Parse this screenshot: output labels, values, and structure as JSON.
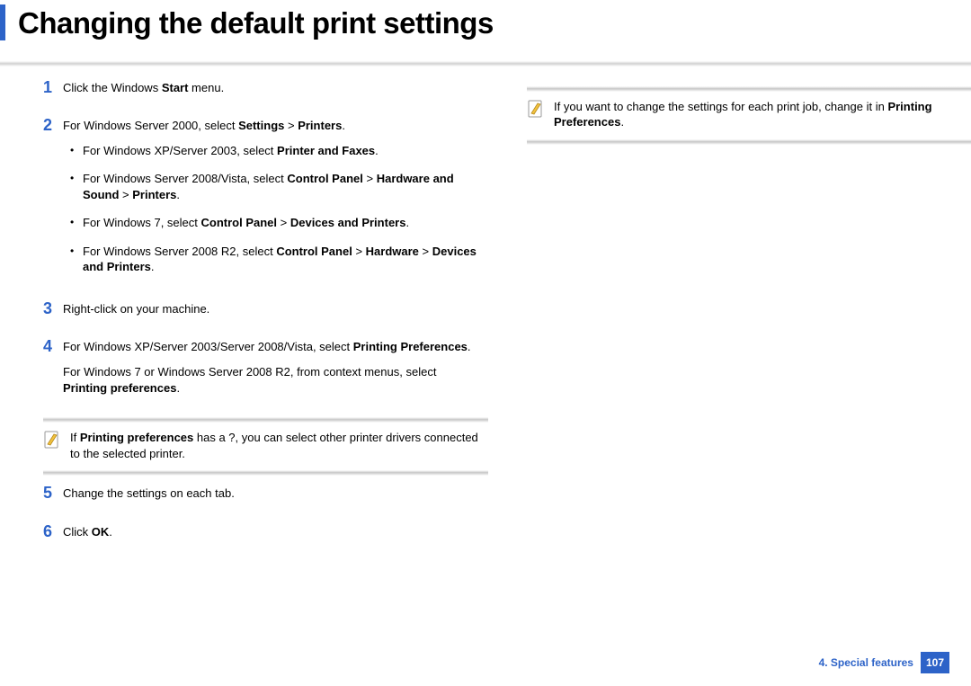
{
  "header": {
    "title": "Changing the default print settings"
  },
  "steps": [
    {
      "num": "1",
      "paras": [
        [
          {
            "t": "Click the Windows "
          },
          {
            "t": "Start",
            "b": true
          },
          {
            "t": " menu."
          }
        ]
      ]
    },
    {
      "num": "2",
      "paras": [
        [
          {
            "t": "For Windows Server 2000, select "
          },
          {
            "t": "Settings",
            "b": true
          },
          {
            "t": " > "
          },
          {
            "t": "Printers",
            "b": true
          },
          {
            "t": "."
          }
        ]
      ],
      "bullets": [
        [
          {
            "t": "For Windows XP/Server 2003, select "
          },
          {
            "t": "Printer and Faxes",
            "b": true
          },
          {
            "t": "."
          }
        ],
        [
          {
            "t": "For Windows Server 2008/Vista, select "
          },
          {
            "t": "Control Panel",
            "b": true
          },
          {
            "t": " > "
          },
          {
            "t": "Hardware and Sound",
            "b": true
          },
          {
            "t": " > "
          },
          {
            "t": "Printers",
            "b": true
          },
          {
            "t": "."
          }
        ],
        [
          {
            "t": "For Windows 7, select "
          },
          {
            "t": "Control Panel",
            "b": true
          },
          {
            "t": " > "
          },
          {
            "t": "Devices and Printers",
            "b": true
          },
          {
            "t": "."
          }
        ],
        [
          {
            "t": "For Windows Server 2008 R2, select "
          },
          {
            "t": "Control Panel",
            "b": true
          },
          {
            "t": " > "
          },
          {
            "t": "Hardware",
            "b": true
          },
          {
            "t": " > "
          },
          {
            "t": "Devices and Printers",
            "b": true
          },
          {
            "t": "."
          }
        ]
      ]
    },
    {
      "num": "3",
      "paras": [
        [
          {
            "t": "Right-click on your machine."
          }
        ]
      ]
    },
    {
      "num": "4",
      "paras": [
        [
          {
            "t": "For Windows XP/Server 2003/Server 2008/Vista, select "
          },
          {
            "t": "Printing Preferences",
            "b": true
          },
          {
            "t": "."
          }
        ],
        [
          {
            "t": "For Windows 7 or Windows Server 2008 R2, from context menus, select "
          },
          {
            "t": "Printing preferences",
            "b": true
          },
          {
            "t": "."
          }
        ]
      ]
    }
  ],
  "note1": [
    {
      "t": "If "
    },
    {
      "t": "Printing preferences",
      "b": true
    },
    {
      "t": " has a ?, you can select other printer drivers connected to the selected printer."
    }
  ],
  "steps_after": [
    {
      "num": "5",
      "paras": [
        [
          {
            "t": "Change the settings on each tab."
          }
        ]
      ]
    },
    {
      "num": "6",
      "paras": [
        [
          {
            "t": "Click "
          },
          {
            "t": "OK",
            "b": true
          },
          {
            "t": "."
          }
        ]
      ]
    }
  ],
  "note2": [
    {
      "t": "If you want to change the settings for each print job, change it in "
    },
    {
      "t": "Printing Preferences",
      "b": true
    },
    {
      "t": "."
    }
  ],
  "footer": {
    "section": "4.  Special features",
    "page": "107"
  }
}
